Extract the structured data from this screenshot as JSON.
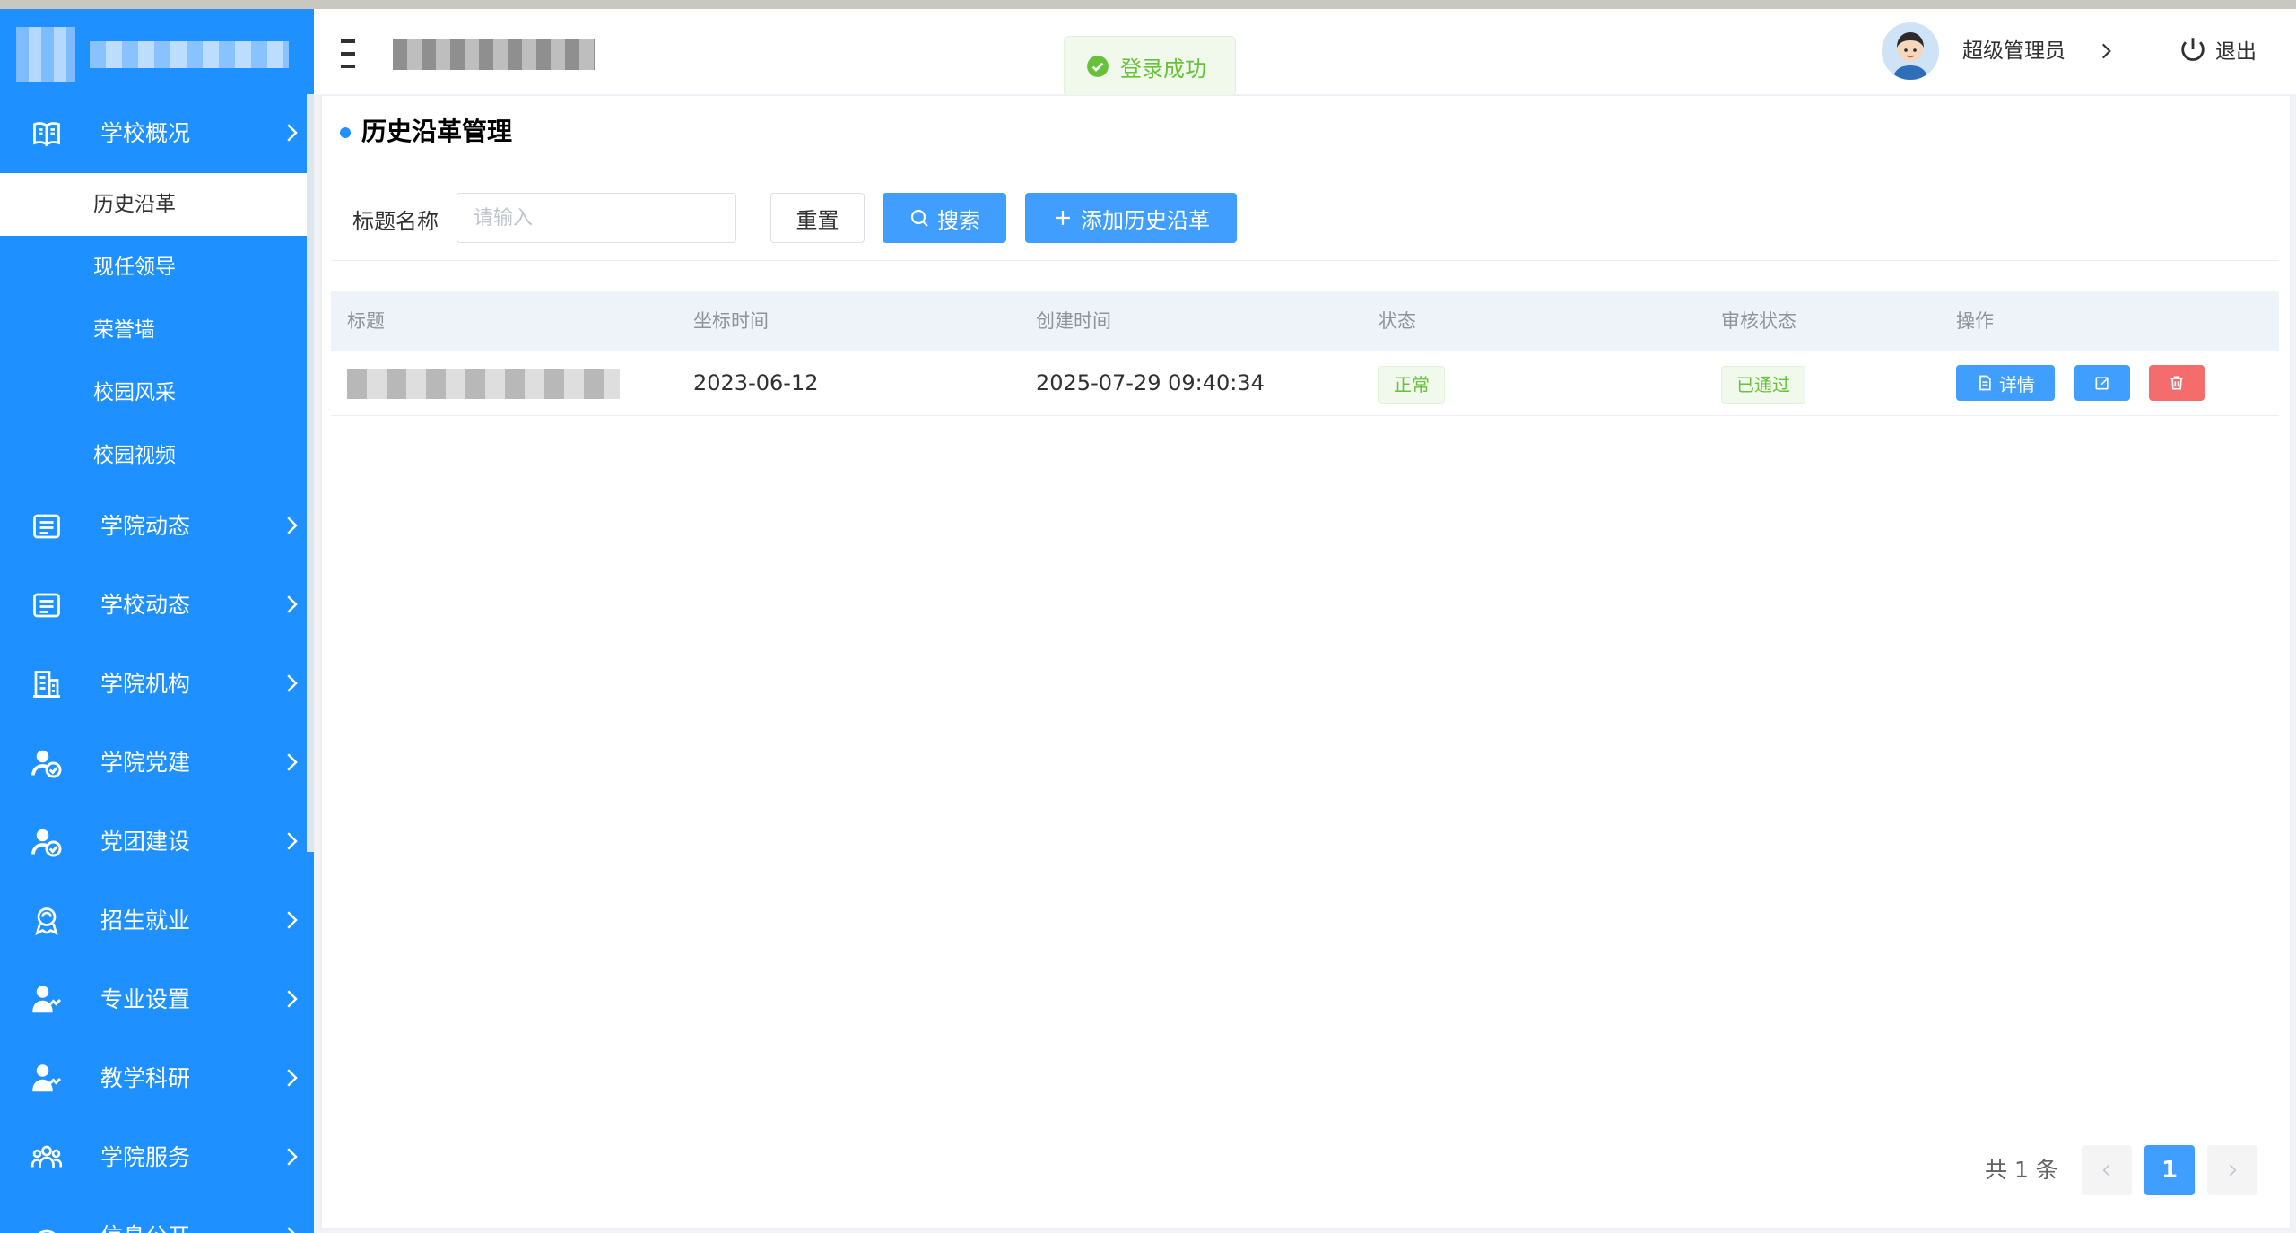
{
  "header": {
    "username": "超级管理员",
    "logout_label": "退出"
  },
  "toast": {
    "message": "登录成功"
  },
  "sidebar": {
    "menu": [
      {
        "label": "学校概况",
        "icon": "book-icon"
      },
      {
        "label": "学院动态",
        "icon": "news-icon"
      },
      {
        "label": "学校动态",
        "icon": "news-icon"
      },
      {
        "label": "学院机构",
        "icon": "building-icon"
      },
      {
        "label": "学院党建",
        "icon": "user-check-icon"
      },
      {
        "label": "党团建设",
        "icon": "user-check-icon"
      },
      {
        "label": "招生就业",
        "icon": "graduate-icon"
      },
      {
        "label": "专业设置",
        "icon": "user-tie-icon"
      },
      {
        "label": "教学科研",
        "icon": "user-tie-icon"
      },
      {
        "label": "学院服务",
        "icon": "group-icon"
      },
      {
        "label": "信息公开",
        "icon": "gauge-icon"
      }
    ],
    "submenu": [
      {
        "label": "历史沿革",
        "active": true
      },
      {
        "label": "现任领导",
        "active": false
      },
      {
        "label": "荣誉墙",
        "active": false
      },
      {
        "label": "校园风采",
        "active": false
      },
      {
        "label": "校园视频",
        "active": false
      }
    ]
  },
  "main": {
    "title": "历史沿革管理",
    "filter": {
      "label": "标题名称",
      "placeholder": "请输入",
      "value": "",
      "reset_label": "重置",
      "search_label": "搜索",
      "add_label": "添加历史沿革"
    },
    "table": {
      "columns": [
        "标题",
        "坐标时间",
        "创建时间",
        "状态",
        "审核状态",
        "操作"
      ],
      "rows": [
        {
          "title": "",
          "coord_time": "2023-06-12",
          "created_at": "2025-07-29 09:40:34",
          "status": "正常",
          "review_status": "已通过",
          "detail_label": "详情"
        }
      ]
    },
    "pagination": {
      "total_text": "共 1 条",
      "current_page": "1"
    }
  },
  "colors": {
    "sidebar_bg": "#1e90ff",
    "primary": "#409eff",
    "danger": "#f56c6c",
    "success": "#67c23a"
  }
}
